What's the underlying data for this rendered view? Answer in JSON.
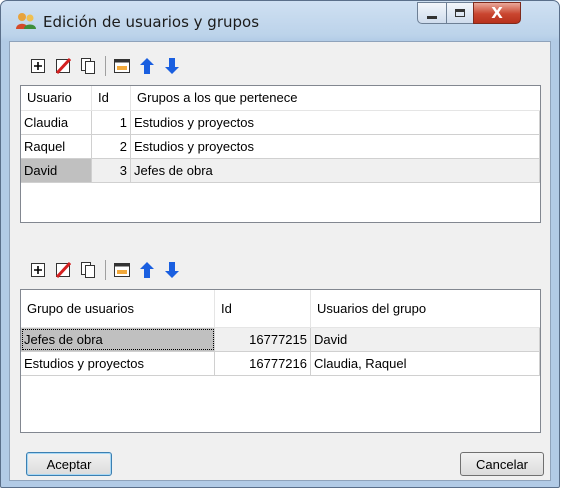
{
  "window": {
    "title": "Edición de usuarios y grupos"
  },
  "icons": {
    "app": "users-group-icon",
    "toolbar": [
      "add-icon",
      "delete-icon",
      "copy-icon",
      "edit-icon",
      "up-arrow-icon",
      "down-arrow-icon"
    ]
  },
  "users_table": {
    "columns": [
      "Usuario",
      "Id",
      "Grupos a los que pertenece"
    ],
    "rows": [
      {
        "usuario": "Claudia",
        "id": "1",
        "grupos": "Estudios y proyectos"
      },
      {
        "usuario": "Raquel",
        "id": "2",
        "grupos": "Estudios y proyectos"
      },
      {
        "usuario": "David",
        "id": "3",
        "grupos": "Jefes de obra"
      }
    ]
  },
  "groups_table": {
    "columns": [
      "Grupo de usuarios",
      "Id",
      "Usuarios del grupo"
    ],
    "rows": [
      {
        "grupo": "Jefes de obra",
        "id": "16777215",
        "usuarios": "David"
      },
      {
        "grupo": "Estudios y proyectos",
        "id": "16777216",
        "usuarios": "Claudia, Raquel"
      }
    ]
  },
  "buttons": {
    "accept": "Aceptar",
    "cancel": "Cancelar"
  },
  "colors": {
    "selection": "#c0c0c0",
    "arrow": "#1a5fe0",
    "delete": "#d42020"
  }
}
